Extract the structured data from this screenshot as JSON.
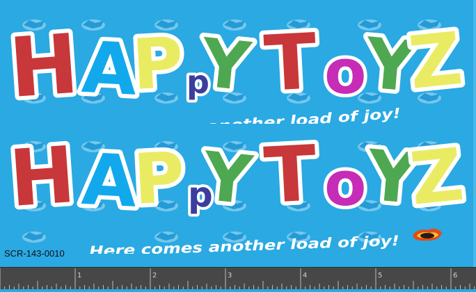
{
  "canvas": {
    "background": "#2aa9e3",
    "part_number": "SCR-143-0010"
  },
  "logo": {
    "letters": [
      {
        "char": "H",
        "color": "#c8373a"
      },
      {
        "char": "A",
        "color": "#11a9ec"
      },
      {
        "char": "P",
        "color": "#e9ec63"
      },
      {
        "char": "p",
        "color": "#3b3e9e"
      },
      {
        "char": "Y",
        "color": "#4ea852"
      },
      {
        "char": "T",
        "color": "#c8373a"
      },
      {
        "char": "o",
        "color": "#c72cb6"
      },
      {
        "char": "Y",
        "color": "#4ea852"
      },
      {
        "char": "Z",
        "color": "#e9ec63"
      }
    ],
    "tagline": "Here comes another load of joy!"
  },
  "watermark_icon": "watermark-logo-icon",
  "badge_icon": "flame-badge-icon",
  "ruler": {
    "marks": [
      "1",
      "2",
      "3",
      "4",
      "5",
      "6"
    ],
    "background": "#474747"
  }
}
